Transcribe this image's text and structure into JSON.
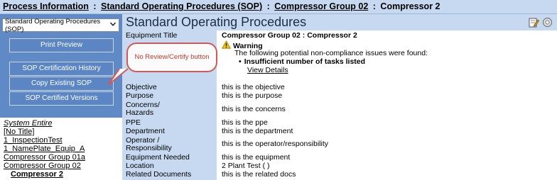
{
  "breadcrumb": {
    "prefix": "Process Information",
    "sep1": ":",
    "link1": "Standard Operating Procedures (SOP)",
    "sep2": ":",
    "link2": "Compressor Group 02",
    "sep3": ":",
    "current": "Compressor 2"
  },
  "sidebar": {
    "select_value": "Standard Operating Procedures (SOP)",
    "buttons": [
      {
        "label": "Print Preview"
      },
      {
        "label": "SOP Certification History"
      },
      {
        "label": "Copy Existing SOP"
      },
      {
        "label": "SOP Certified Versions"
      }
    ],
    "tree": [
      {
        "label": "System Entire"
      },
      {
        "label": "[No Title]"
      },
      {
        "label": "1_InspectionTest"
      },
      {
        "label": "1_NamePlate_Equip_A"
      },
      {
        "label": "Compressor Group 01a"
      },
      {
        "label": "Compressor Group 02"
      },
      {
        "label": "Compressor 2"
      }
    ]
  },
  "callout": {
    "text": "No Review/Certify button"
  },
  "main": {
    "title": "Standard Operating Procedures",
    "icons": [
      "edit-icon",
      "settings-icon"
    ],
    "equipment_title_label": "Equipment Title",
    "equipment_title_value": "Compressor Group 02 : Compressor 2",
    "warning": {
      "heading": "Warning",
      "text": "The following potential non-compliance issues were found:",
      "item": "Insufficient number of tasks listed",
      "link": "View Details"
    },
    "rows": [
      {
        "label": "Objective",
        "value": "this is the objective"
      },
      {
        "label": "Purpose",
        "value": "this is the purpose"
      },
      {
        "label": "Concerns/ Hazards",
        "value": "this is the concerns"
      },
      {
        "label": "PPE",
        "value": "this is the ppe"
      },
      {
        "label": "Department",
        "value": "this is the department"
      },
      {
        "label": "Operator / Responsibility",
        "value": "this is the operator/responsibility"
      },
      {
        "label": "Equipment Needed",
        "value": "this is the equipment"
      },
      {
        "label": "Location",
        "value": "2 Plant Test ( )"
      },
      {
        "label": "Related Documents",
        "value": "this is the related docs"
      }
    ]
  },
  "colors": {
    "header_bg": "#c6d9f1",
    "sidebar_bg": "#5f8ac6",
    "callout_border": "#d05a5a",
    "warning_yellow": "#f2c200"
  }
}
